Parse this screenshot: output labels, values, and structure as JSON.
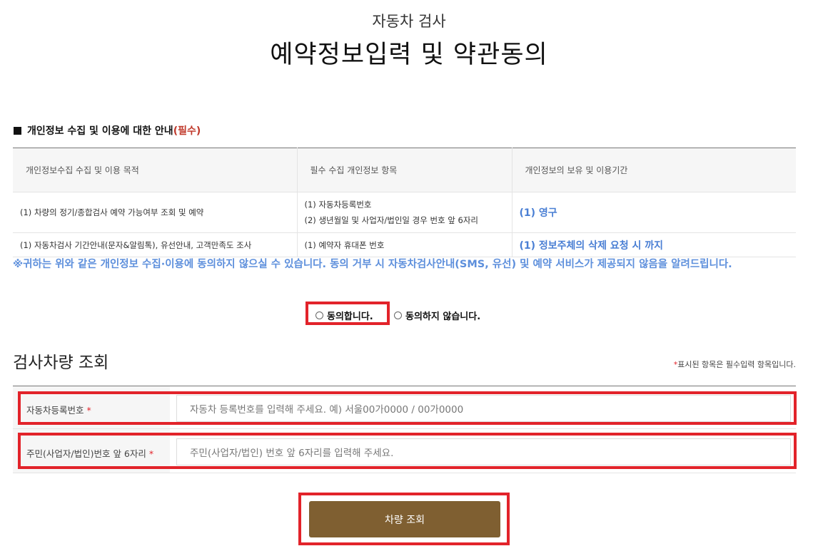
{
  "header": {
    "subtitle": "자동차 검사",
    "title": "예약정보입력 및 약관동의"
  },
  "privacy": {
    "heading": "개인정보 수집 및 이용에 대한 안내",
    "required_tag": "(필수)",
    "columns": [
      "개인정보수집 수집 및 이용 목적",
      "필수 수집 개인정보 항목",
      "개인정보의 보유 및 이용기간"
    ],
    "rows": [
      {
        "purpose": "(1) 차량의 정기/종합검사 예약 가능여부 조회 및 예약",
        "items": [
          "(1) 자동차등록번호",
          "(2) 생년월일 및 사업자/법인일 경우 번호 앞 6자리"
        ],
        "period": "(1) 영구"
      },
      {
        "purpose": "(1) 자동차검사 기간안내(문자&알림톡), 유선안내, 고객만족도 조사",
        "items": [
          "(1) 예약자 휴대폰 번호"
        ],
        "period": "(1) 정보주체의 삭제 요청 시 까지"
      }
    ],
    "notice": "※귀하는 위와 같은 개인정보 수집·이용에 동의하지 않으실 수 있습니다. 동의 거부 시 자동차검사안내(SMS, 유선) 및 예약 서비스가 제공되지 않음을 알려드립니다."
  },
  "consent": {
    "agree_label": "동의합니다.",
    "disagree_label": "동의하지 않습니다."
  },
  "lookup": {
    "title": "검사차량 조회",
    "required_note_star": "*",
    "required_note": "표시된 항목은 필수입력 항목입니다.",
    "fields": [
      {
        "label": "자동차등록번호",
        "star": "*",
        "placeholder": "자동차 등록번호를 입력해 주세요. 예) 서울00가0000 / 00가0000"
      },
      {
        "label": "주민(사업자/법인)번호 앞 6자리",
        "star": "*",
        "placeholder": "주민(사업자/법인) 번호 앞 6자리를 입력해 주세요."
      }
    ],
    "submit_label": "차량 조회"
  },
  "colors": {
    "accent_brown": "#7f5f31",
    "highlight_red": "#e2232a",
    "notice_blue": "#5d8fdc"
  }
}
